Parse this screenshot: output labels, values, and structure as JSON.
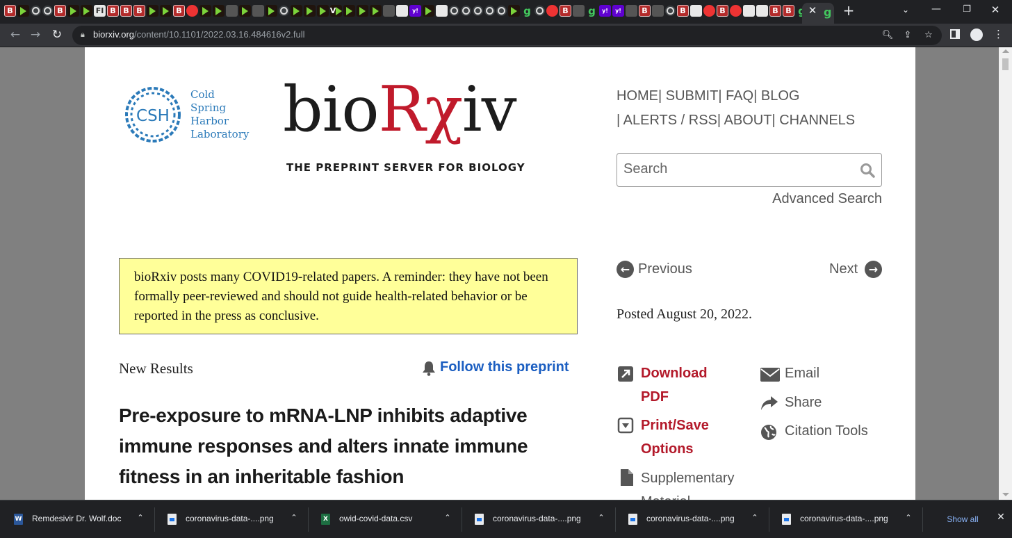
{
  "browser": {
    "tab_favicons": [
      "B",
      "D",
      "S",
      "S",
      "B",
      "D",
      "D",
      "FI",
      "B",
      "B",
      "B",
      "D",
      "D",
      "B",
      "R",
      "D",
      "D",
      "K",
      "D",
      "K",
      "D",
      "S",
      "D",
      "D",
      "D",
      "V",
      "D",
      "D",
      "D",
      "K",
      "W",
      "Y",
      "D",
      "W",
      "S",
      "S",
      "S",
      "S",
      "S",
      "D",
      "G",
      "S",
      "R",
      "B",
      "K",
      "G",
      "Y",
      "Y",
      "K",
      "B",
      "K",
      "S",
      "B",
      "W",
      "R",
      "B",
      "R",
      "W",
      "W",
      "B",
      "B",
      "G",
      "Y"
    ],
    "active_tab_favicon": "g",
    "close_tab_icon": "close-icon",
    "new_tab_label": "+",
    "url_host": "biorxiv.org",
    "url_path": "/content/10.1101/2022.03.16.484616v2.full"
  },
  "site": {
    "csh_logo_text": "CSH",
    "csh_name_lines": [
      "Cold",
      "Spring",
      "Harbor",
      "Laboratory"
    ],
    "wordmark_black_1": "bio",
    "wordmark_red": "Rχ",
    "wordmark_black_2": "iv",
    "tagline": "THE PREPRINT SERVER FOR BIOLOGY",
    "nav": {
      "home": "HOME",
      "submit": "SUBMIT",
      "faq": "FAQ",
      "blog": "BLOG",
      "alerts": "ALERTS / RSS",
      "about": "ABOUT",
      "channels": "CHANNELS",
      "separator": "|"
    },
    "search_placeholder": "Search",
    "advanced_search": "Advanced Search"
  },
  "notice": {
    "text": "bioRxiv posts many COVID19-related papers. A reminder: they have not been formally peer-reviewed and should not guide health-related behavior or be reported in the press as conclusive."
  },
  "article": {
    "type": "New Results",
    "follow_label": "Follow this preprint",
    "title": "Pre-exposure to mRNA-LNP inhibits adaptive immune responses and alters innate immune fitness in an inheritable fashion"
  },
  "sidebar": {
    "previous": "Previous",
    "next": "Next",
    "posted": "Posted August 20, 2022.",
    "download_pdf": "Download PDF",
    "print_save": "Print/Save Options",
    "supplementary": "Supplementary Material",
    "email": "Email",
    "share": "Share",
    "citation_tools": "Citation Tools"
  },
  "downloads": {
    "items": [
      {
        "name": "Remdesivir Dr. Wolf.doc",
        "type": "word"
      },
      {
        "name": "coronavirus-data-....png",
        "type": "image"
      },
      {
        "name": "owid-covid-data.csv",
        "type": "excel"
      },
      {
        "name": "coronavirus-data-....png",
        "type": "image"
      },
      {
        "name": "coronavirus-data-....png",
        "type": "image"
      },
      {
        "name": "coronavirus-data-....png",
        "type": "image"
      }
    ],
    "show_all": "Show all"
  },
  "colors": {
    "brand_red": "#c01a2b",
    "link_blue": "#1b5ec1",
    "notice_yellow": "#ffff99",
    "csh_blue": "#2b7ab9"
  }
}
